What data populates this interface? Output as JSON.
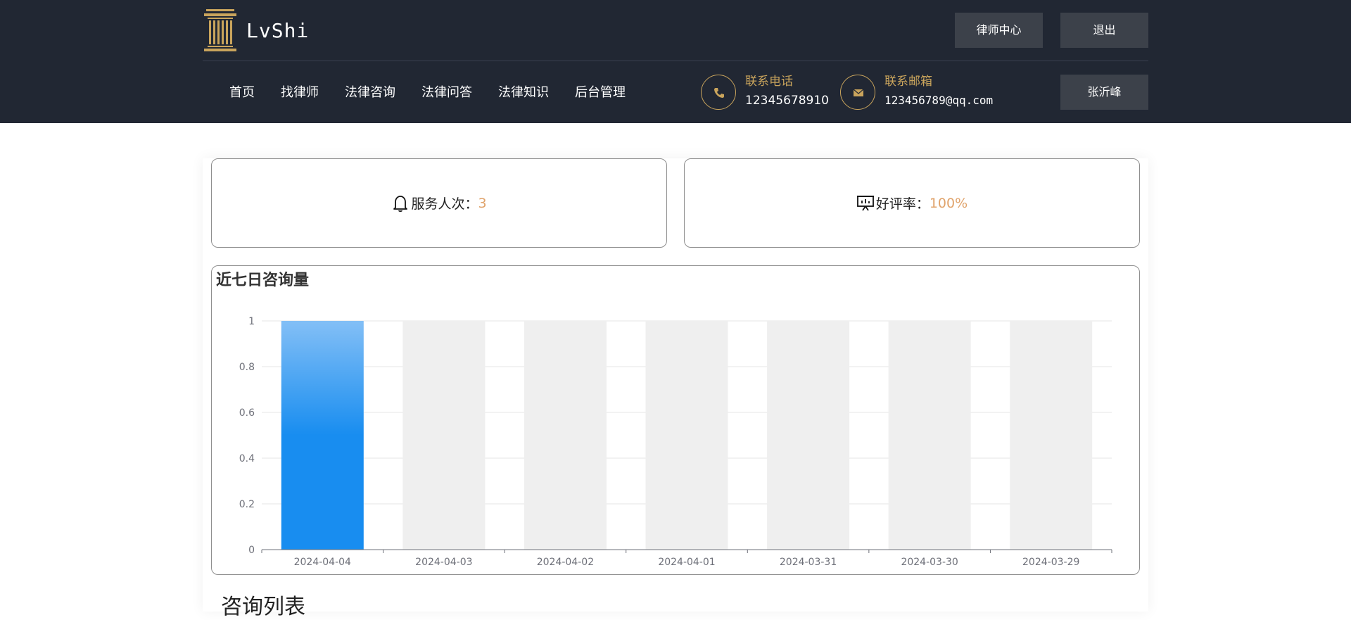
{
  "header": {
    "logo_text": "LvShi",
    "lawyer_center_label": "律师中心",
    "logout_label": "退出",
    "user_label": "张沂峰",
    "nav": [
      {
        "label": "首页"
      },
      {
        "label": "找律师"
      },
      {
        "label": "法律咨询"
      },
      {
        "label": "法律问答"
      },
      {
        "label": "法律知识"
      },
      {
        "label": "后台管理"
      }
    ],
    "phone": {
      "label": "联系电话",
      "value": "12345678910",
      "icon": "phone-icon"
    },
    "email": {
      "label": "联系邮箱",
      "value": "123456789@qq.com",
      "icon": "mail-icon"
    }
  },
  "stats": {
    "service": {
      "label": "服务人次：",
      "value": "3",
      "icon": "bell-icon"
    },
    "rating": {
      "label": "好评率：",
      "value": "100%",
      "icon": "presentation-icon"
    }
  },
  "chart": {
    "title": "近七日咨询量"
  },
  "list": {
    "title": "咨询列表"
  },
  "colors": {
    "header_bg": "#212733",
    "gold": "#c9a45c",
    "button_bg": "#3c414a",
    "stat_value": "#e0a36b",
    "bar_top": "#83bff6",
    "bar_bottom": "#188df0",
    "bar_background": "#efefef"
  },
  "chart_data": {
    "type": "bar",
    "categories": [
      "2024-04-04",
      "2024-04-03",
      "2024-04-02",
      "2024-04-01",
      "2024-03-31",
      "2024-03-30",
      "2024-03-29"
    ],
    "values": [
      1,
      0,
      0,
      0,
      0,
      0,
      0
    ],
    "yticks": [
      "0",
      "0.2",
      "0.4",
      "0.6",
      "0.8",
      "1"
    ],
    "ylim": [
      0,
      1
    ],
    "grid": true,
    "title": "近七日咨询量",
    "xlabel": "",
    "ylabel": ""
  }
}
